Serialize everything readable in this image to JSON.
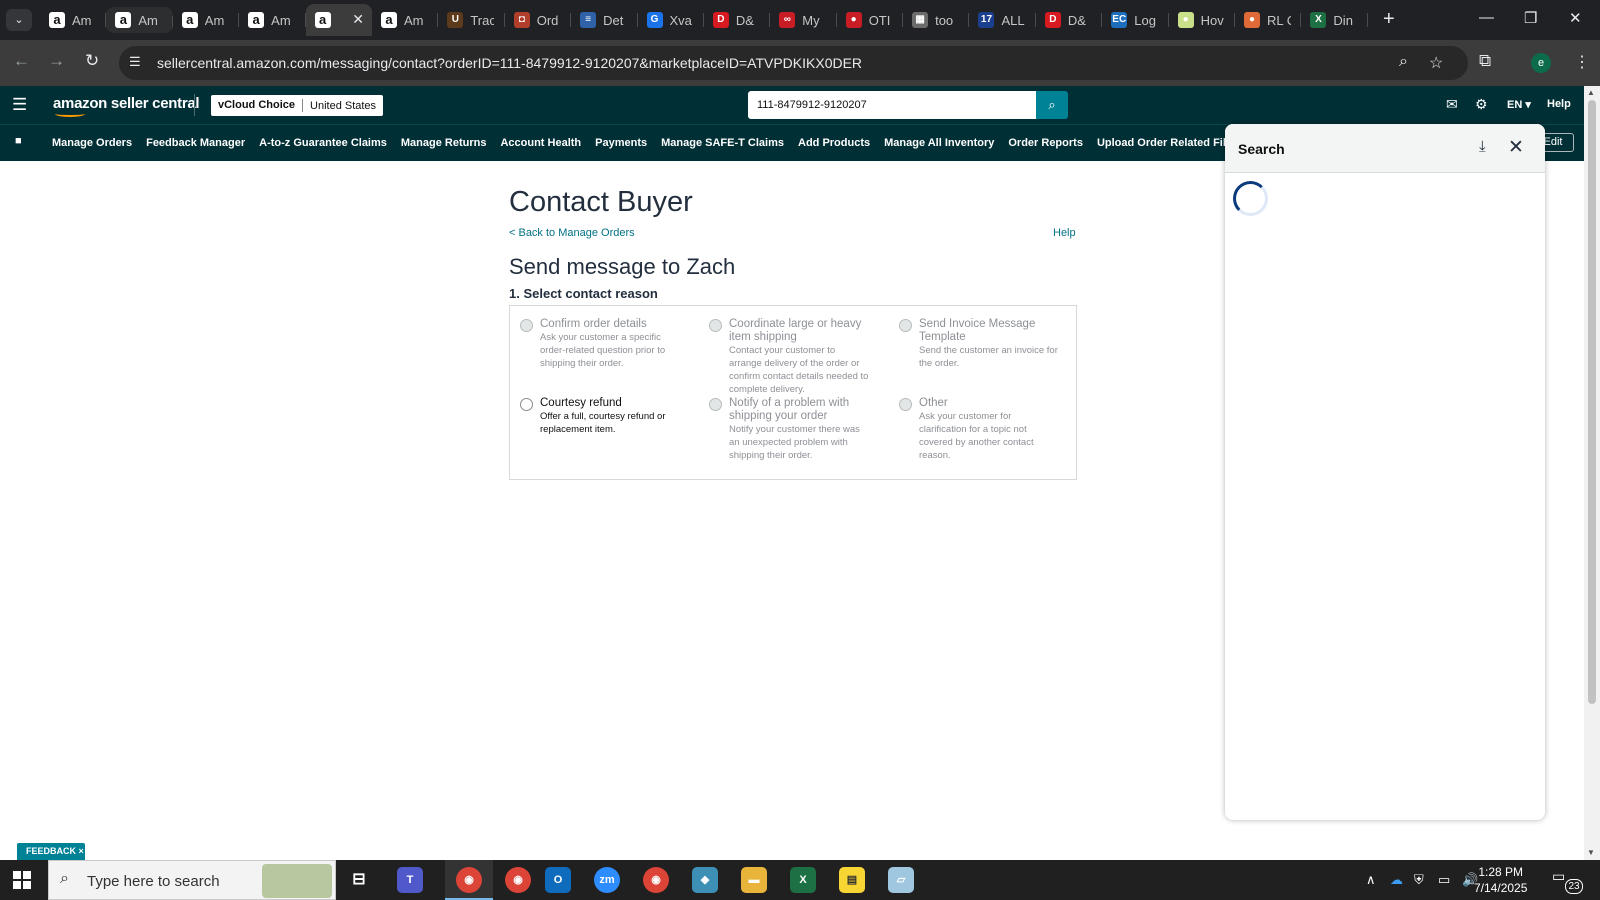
{
  "browser": {
    "tabs": [
      {
        "title": "Am",
        "favicon": "amazon-icon"
      },
      {
        "title": "Am",
        "favicon": "amazon-icon"
      },
      {
        "title": "Am",
        "favicon": "amazon-icon"
      },
      {
        "title": "Am",
        "favicon": "amazon-icon"
      },
      {
        "title": "",
        "favicon": "amazon-icon"
      },
      {
        "title": "Am",
        "favicon": "amazon-icon"
      },
      {
        "title": "Trac",
        "favicon": "ups-icon"
      },
      {
        "title": "Ord",
        "favicon": "order-icon"
      },
      {
        "title": "Det",
        "favicon": "detail-icon"
      },
      {
        "title": "Xva",
        "favicon": "xva-icon"
      },
      {
        "title": "D&",
        "favicon": "dh-icon"
      },
      {
        "title": "My",
        "favicon": "my-icon"
      },
      {
        "title": "OTI",
        "favicon": "oti-icon"
      },
      {
        "title": "too",
        "favicon": "tool-icon"
      },
      {
        "title": "ALL",
        "favicon": "all-icon"
      },
      {
        "title": "D&",
        "favicon": "dh-icon"
      },
      {
        "title": "Log",
        "favicon": "ec-icon"
      },
      {
        "title": "Hov",
        "favicon": "hov-icon"
      },
      {
        "title": "RL C",
        "favicon": "rl-icon"
      },
      {
        "title": "Din",
        "favicon": "excel-icon"
      }
    ],
    "url": "sellercentral.amazon.com/messaging/contact?orderID=111-8479912-9120207&marketplaceID=ATVPDKIKX0DER",
    "profile_initial": "e"
  },
  "header": {
    "logo": "amazon seller central",
    "store": "vCloud Choice",
    "marketplace": "United States",
    "search_value": "111-8479912-9120207",
    "language": "EN",
    "help": "Help"
  },
  "nav": {
    "items": [
      "Manage Orders",
      "Feedback Manager",
      "A-to-z Guarantee Claims",
      "Manage Returns",
      "Account Health",
      "Payments",
      "Manage SAFE-T Claims",
      "Add Products",
      "Manage All Inventory",
      "Order Reports",
      "Upload Order Related Files"
    ],
    "edit": "Edit"
  },
  "main": {
    "title": "Contact Buyer",
    "back_link": "< Back to Manage Orders",
    "help_link": "Help",
    "message_heading": "Send message to Zach",
    "reason_heading": "1. Select contact reason",
    "reasons": [
      {
        "title": "Confirm order details",
        "desc": "Ask your customer a specific order-related question prior to shipping their order.",
        "enabled": false
      },
      {
        "title": "Coordinate large or heavy item shipping",
        "desc": "Contact your customer to arrange delivery of the order or confirm contact details needed to complete delivery.",
        "enabled": false
      },
      {
        "title": "Send Invoice Message Template",
        "desc": "Send the customer an invoice for the order.",
        "enabled": false
      },
      {
        "title": "Courtesy refund",
        "desc": "Offer a full, courtesy refund or replacement item.",
        "enabled": true
      },
      {
        "title": "Notify of a problem with shipping your order",
        "desc": "Notify your customer there was an unexpected problem with shipping their order.",
        "enabled": false
      },
      {
        "title": "Other",
        "desc": "Ask your customer for clarification for a topic not covered by another contact reason.",
        "enabled": false
      }
    ]
  },
  "search_panel": {
    "title": "Search"
  },
  "feedback": "FEEDBACK ×",
  "taskbar": {
    "search_placeholder": "Type here to search",
    "time": "1:28 PM",
    "date": "7/14/2025",
    "notification_count": "23"
  }
}
